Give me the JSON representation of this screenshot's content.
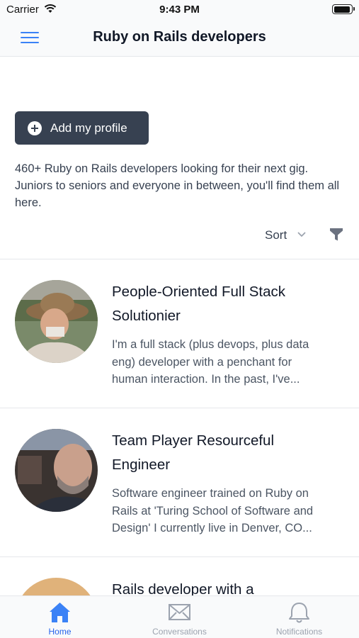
{
  "status_bar": {
    "carrier": "Carrier",
    "time": "9:43 PM"
  },
  "nav": {
    "title": "Ruby on Rails developers",
    "menu_icon": "hamburger-menu-icon"
  },
  "actions": {
    "add_profile_label": "Add my profile",
    "add_icon": "plus-circle-icon"
  },
  "intro": {
    "text": "460+ Ruby on Rails developers looking for their next gig. Juniors to seniors and everyone in between, you'll find them all here."
  },
  "controls": {
    "sort_label": "Sort",
    "filter_icon": "filter-icon"
  },
  "developers": [
    {
      "title_line1": "People-Oriented Full Stack",
      "title_line2": "Solutionier",
      "desc_line1": "I'm a full stack (plus devops, plus data",
      "desc_line2": "eng) developer with a penchant for",
      "desc_line3": "human interaction. In the past, I've..."
    },
    {
      "title_line1": "Team Player Resourceful",
      "title_line2": "Engineer",
      "desc_line1": "Software engineer trained on Ruby on",
      "desc_line2": "Rails at 'Turing School of Software and",
      "desc_line3": "Design' I currently live in Denver, CO..."
    },
    {
      "title_line1": "Rails developer with a"
    }
  ],
  "tabs": [
    {
      "label": "Home",
      "icon": "home-icon",
      "active": true
    },
    {
      "label": "Conversations",
      "icon": "envelope-icon",
      "active": false
    },
    {
      "label": "Notifications",
      "icon": "bell-icon",
      "active": false
    }
  ],
  "colors": {
    "accent": "#2563eb",
    "button_bg": "#374151",
    "menu_icon": "#3b82f6"
  }
}
